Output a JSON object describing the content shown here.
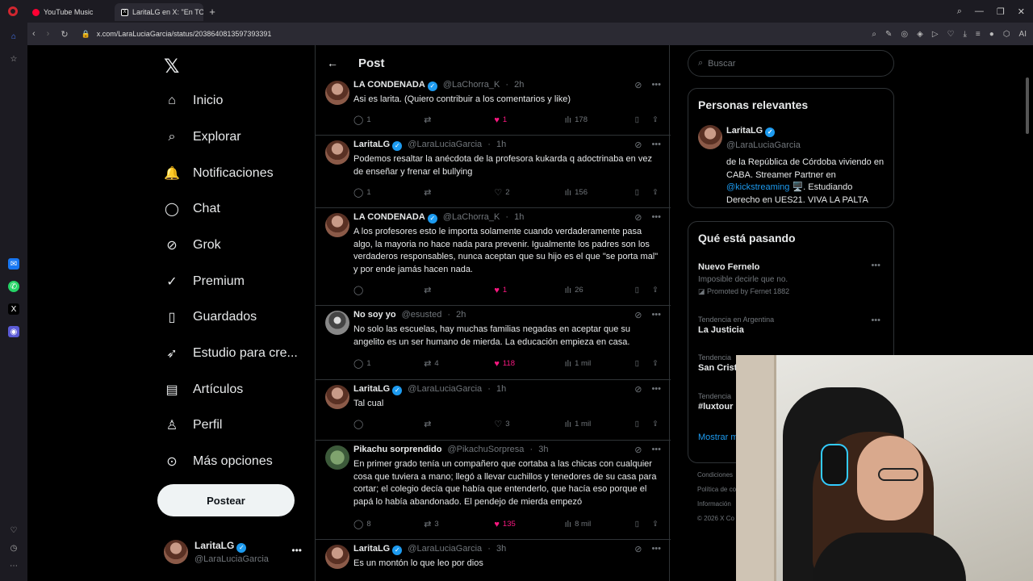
{
  "browser": {
    "tabs": [
      {
        "label": "YouTube Music",
        "icon": "youtube-music-icon"
      },
      {
        "label": "LaritaLG en X: \"En TODAS",
        "icon": "x-logo-icon"
      }
    ],
    "url": "x.com/LaraLuciaGarcia/status/2038640813597393391"
  },
  "sidebar": {
    "items": [
      {
        "label": "Inicio",
        "icon": "home-icon"
      },
      {
        "label": "Explorar",
        "icon": "search-icon"
      },
      {
        "label": "Notificaciones",
        "icon": "bell-icon"
      },
      {
        "label": "Chat",
        "icon": "chat-icon"
      },
      {
        "label": "Grok",
        "icon": "grok-icon"
      },
      {
        "label": "Premium",
        "icon": "verified-badge-icon"
      },
      {
        "label": "Guardados",
        "icon": "bookmark-icon"
      },
      {
        "label": "Estudio para cre...",
        "icon": "rocket-icon"
      },
      {
        "label": "Artículos",
        "icon": "article-icon"
      },
      {
        "label": "Perfil",
        "icon": "person-icon"
      },
      {
        "label": "Más opciones",
        "icon": "more-circle-icon"
      }
    ],
    "post_button": "Postear",
    "account": {
      "name": "LaritaLG",
      "handle": "@LaraLuciaGarcia"
    }
  },
  "main": {
    "title": "Post",
    "tweets": [
      {
        "name": "LA CONDENADA",
        "handle": "@LaChorra_K",
        "time": "2h",
        "text": "Asi es larita. (Quiero contribuir a los comentarios y like)",
        "replies": "1",
        "reposts": "",
        "likes": "1",
        "liked": true,
        "views": "178"
      },
      {
        "name": "LaritaLG",
        "handle": "@LaraLuciaGarcia",
        "time": "1h",
        "text": "Podemos resaltar la anécdota de la profesora kukarda q adoctrinaba en vez de enseñar y frenar el bullying",
        "replies": "1",
        "reposts": "",
        "likes": "2",
        "liked": false,
        "views": "156"
      },
      {
        "name": "LA CONDENADA",
        "handle": "@LaChorra_K",
        "time": "1h",
        "text": "A los profesores esto le importa solamente cuando verdaderamente pasa algo, la mayoria no hace nada para prevenir. Igualmente los padres son los verdaderos responsables, nunca aceptan que su hijo es el que \"se porta mal\" y por ende jamás hacen nada.",
        "replies": "",
        "reposts": "",
        "likes": "1",
        "liked": true,
        "views": "26"
      },
      {
        "name": "No soy yo",
        "handle": "@esusted",
        "time": "2h",
        "text": "No solo las escuelas, hay muchas familias negadas en aceptar que su angelito es un ser humano de mierda. La educación empieza en casa.",
        "replies": "1",
        "reposts": "4",
        "likes": "118",
        "liked": true,
        "views": "1 mil"
      },
      {
        "name": "LaritaLG",
        "handle": "@LaraLuciaGarcia",
        "time": "1h",
        "text": "Tal cual",
        "replies": "",
        "reposts": "",
        "likes": "3",
        "liked": false,
        "views": "1 mil"
      },
      {
        "name": "Pikachu sorprendido",
        "handle": "@PikachuSorpresa",
        "time": "3h",
        "text": "En primer grado tenía un compañero que cortaba a las chicas con cualquier cosa que tuviera a mano; llegó a llevar cuchillos y tenedores de su casa para cortar; el colegio decía que había que entenderlo, que hacía eso porque el papá lo había abandonado. El pendejo de mierda empezó",
        "replies": "8",
        "reposts": "3",
        "likes": "135",
        "liked": true,
        "views": "8 mil"
      },
      {
        "name": "LaritaLG",
        "handle": "@LaraLuciaGarcia",
        "time": "3h",
        "text": "Es un montón lo que leo por dios"
      }
    ]
  },
  "right": {
    "search_placeholder": "Buscar",
    "relevant_title": "Personas relevantes",
    "relevant_user": {
      "name": "LaritaLG",
      "handle": "@LaraLuciaGarcia",
      "bio_1": "de la República de Córdoba viviendo en CABA. Streamer Partner en ",
      "bio_link": "@kickstreaming",
      "bio_2": " 🖥️. Estudiando Derecho en UES21. VIVA LA PALTA"
    },
    "trending_title": "Qué está pasando",
    "trends": [
      {
        "label": "",
        "name": "Nuevo Fernelo",
        "sub": "Imposible decirle que no.",
        "promo": "Promoted by Fernet 1882"
      },
      {
        "label": "Tendencia en Argentina",
        "name": "La Justicia"
      },
      {
        "label": "Tendencia",
        "name": "San Crist"
      },
      {
        "label": "Tendencia",
        "name": "#luxtour"
      }
    ],
    "show_more": "Mostrar m",
    "footer": [
      "Condiciones",
      "Política de co",
      "Información",
      "© 2026 X Co"
    ]
  }
}
